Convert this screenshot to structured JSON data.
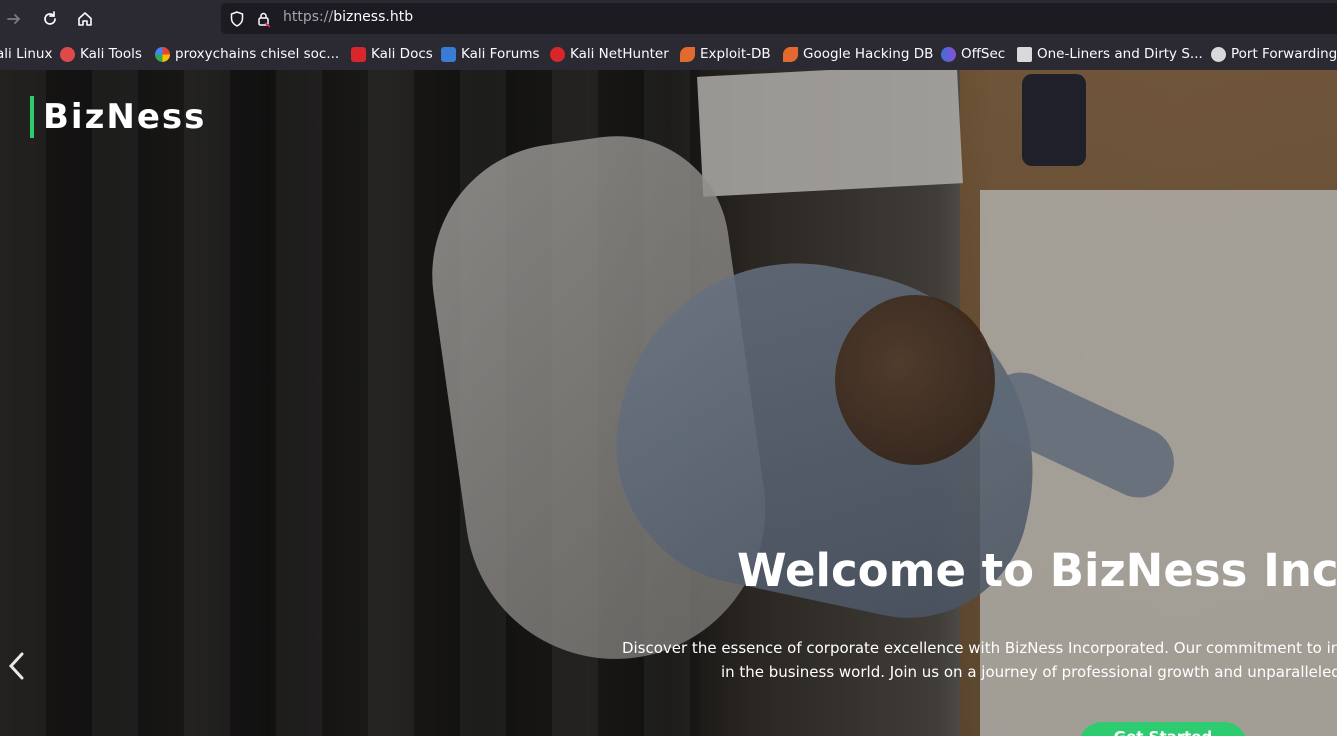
{
  "browser": {
    "url_scheme": "https://",
    "url_host": "bizness.htb"
  },
  "bookmarks": [
    {
      "label": "ali Linux",
      "icon": "kali-linux-icon",
      "color": "#2f6fd6"
    },
    {
      "label": "Kali Tools",
      "icon": "kali-tools-icon",
      "color": "#e0494a"
    },
    {
      "label": "proxychains chisel soc...",
      "icon": "google-icon",
      "color": "#ffffff"
    },
    {
      "label": "Kali Docs",
      "icon": "kali-docs-icon",
      "color": "#d8262b"
    },
    {
      "label": "Kali Forums",
      "icon": "kali-forums-icon",
      "color": "#3a7bd5"
    },
    {
      "label": "Kali NetHunter",
      "icon": "kali-nethunter-icon",
      "color": "#d8262b"
    },
    {
      "label": "Exploit-DB",
      "icon": "exploit-db-icon",
      "color": "#e36a2e"
    },
    {
      "label": "Google Hacking DB",
      "icon": "ghdb-icon",
      "color": "#e36a2e"
    },
    {
      "label": "OffSec",
      "icon": "offsec-icon",
      "color": "#6b5bd6"
    },
    {
      "label": "One-Liners and Dirty S...",
      "icon": "document-icon",
      "color": "#d9d9d9"
    },
    {
      "label": "Port Forwarding",
      "icon": "wordpress-icon",
      "color": "#d9d9d9"
    }
  ],
  "site": {
    "logo": "BizNess",
    "hero_title": "Welcome to BizNess Incorporated",
    "hero_text": "Discover the essence of corporate excellence with BizNess Incorporated. Our commitment to innovation sets us apart in the business world. Join us on a journey of professional growth and unparalleled success.",
    "cta_label": "Get Started",
    "accent_color": "#2ecc71"
  }
}
